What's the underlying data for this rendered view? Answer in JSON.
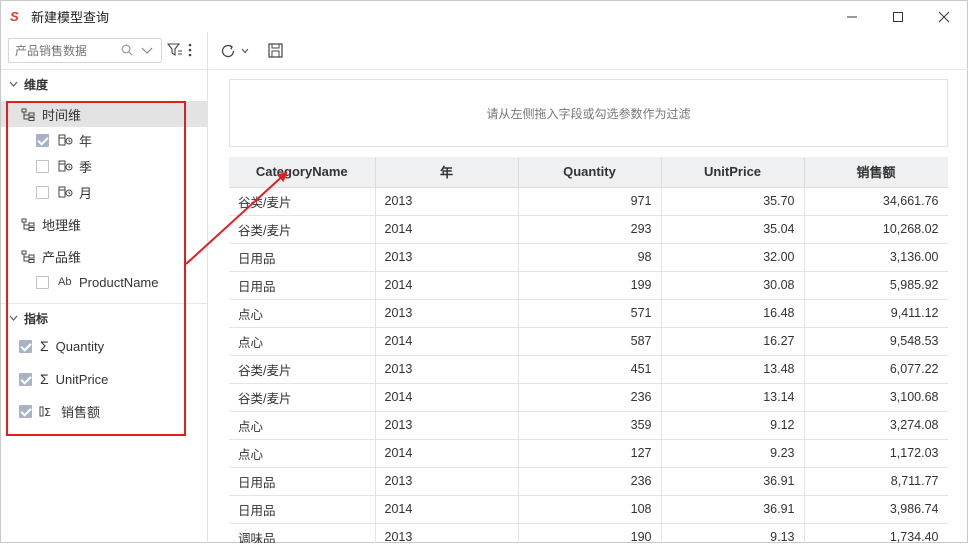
{
  "window": {
    "title": "新建模型查询",
    "logo_glyph": "S",
    "buttons": [
      "minimize",
      "maximize",
      "close"
    ]
  },
  "sidebar": {
    "search": {
      "placeholder": "产品销售数据"
    },
    "dimensions_header": "维度",
    "time_dim": {
      "label": "时间维",
      "children": [
        {
          "label": "年",
          "checked": true
        },
        {
          "label": "季",
          "checked": false
        },
        {
          "label": "月",
          "checked": false
        }
      ]
    },
    "geo_dim": {
      "label": "地理维"
    },
    "product_dim": {
      "label": "产品维",
      "children": [
        {
          "label": "ProductName",
          "type_glyph": "Ab",
          "checked": false
        }
      ]
    },
    "metrics_header": "指标",
    "metrics": [
      {
        "label": "Quantity",
        "checked": true
      },
      {
        "label": "UnitPrice",
        "checked": true
      },
      {
        "label": "销售额",
        "checked": true
      }
    ]
  },
  "main": {
    "filter_hint": "请从左侧拖入字段或勾选参数作为过滤",
    "columns": [
      "CategoryName",
      "年",
      "Quantity",
      "UnitPrice",
      "销售额"
    ],
    "rows": [
      [
        "谷类/麦片",
        "2013",
        "971",
        "35.70",
        "34,661.76"
      ],
      [
        "谷类/麦片",
        "2014",
        "293",
        "35.04",
        "10,268.02"
      ],
      [
        "日用品",
        "2013",
        "98",
        "32.00",
        "3,136.00"
      ],
      [
        "日用品",
        "2014",
        "199",
        "30.08",
        "5,985.92"
      ],
      [
        "点心",
        "2013",
        "571",
        "16.48",
        "9,411.12"
      ],
      [
        "点心",
        "2014",
        "587",
        "16.27",
        "9,548.53"
      ],
      [
        "谷类/麦片",
        "2013",
        "451",
        "13.48",
        "6,077.22"
      ],
      [
        "谷类/麦片",
        "2014",
        "236",
        "13.14",
        "3,100.68"
      ],
      [
        "点心",
        "2013",
        "359",
        "9.12",
        "3,274.08"
      ],
      [
        "点心",
        "2014",
        "127",
        "9.23",
        "1,172.03"
      ],
      [
        "日用品",
        "2013",
        "236",
        "36.91",
        "8,711.77"
      ],
      [
        "日用品",
        "2014",
        "108",
        "36.91",
        "3,986.74"
      ],
      [
        "调味品",
        "2013",
        "190",
        "9.13",
        "1,734.40"
      ]
    ]
  },
  "colors": {
    "annotation": "#e02020",
    "checkbox_checked": "#a9b2c7",
    "header_bg": "#eef0f2"
  }
}
